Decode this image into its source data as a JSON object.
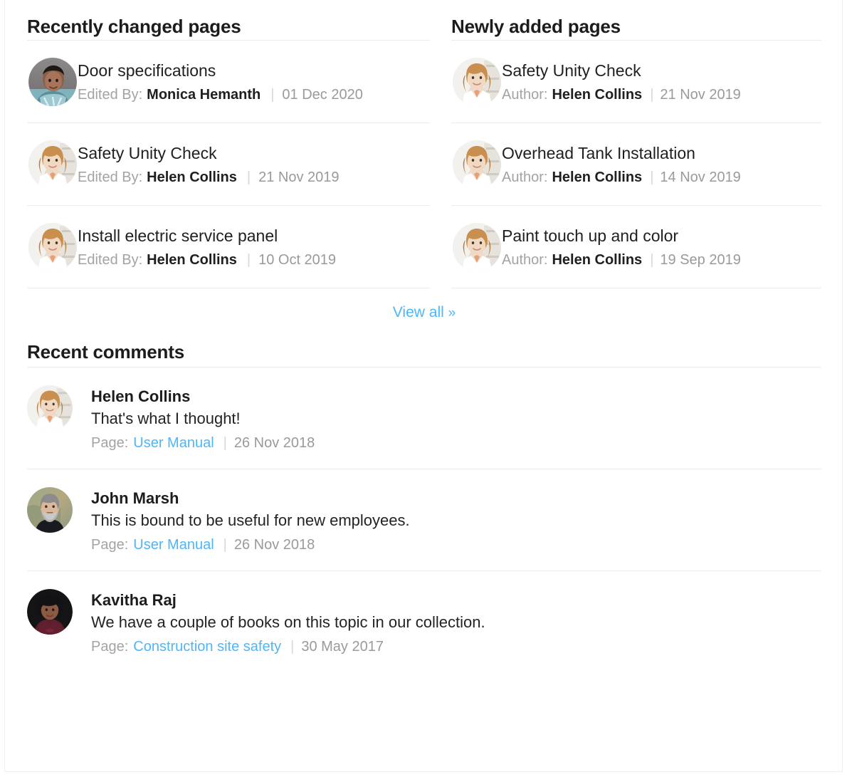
{
  "colors": {
    "link": "#4db6fb",
    "heading": "#1c1c1c",
    "muted": "#9a9a9a",
    "divider": "#ececec"
  },
  "recently_changed": {
    "title": "Recently changed pages",
    "items": [
      {
        "page": "Door  specifications",
        "label": "Edited By:",
        "user": "Monica Hemanth",
        "separator": "|",
        "date": "01 Dec 2020",
        "avatar": "monica"
      },
      {
        "page": "Safety Unity Check",
        "label": "Edited By:",
        "user": "Helen Collins",
        "separator": "|",
        "date": "21 Nov 2019",
        "avatar": "helen"
      },
      {
        "page": "Install electric service panel",
        "label": "Edited By:",
        "user": "Helen Collins",
        "separator": "|",
        "date": "10 Oct 2019",
        "avatar": "helen"
      }
    ]
  },
  "newly_added": {
    "title": "Newly added pages",
    "items": [
      {
        "page": "Safety Unity Check",
        "label": "Author:",
        "user": "Helen Collins",
        "separator": "|",
        "date": "21 Nov 2019",
        "avatar": "helen"
      },
      {
        "page": "Overhead Tank Installation",
        "label": "Author:",
        "user": "Helen Collins",
        "separator": "|",
        "date": "14 Nov 2019",
        "avatar": "helen"
      },
      {
        "page": "Paint touch up and color",
        "label": "Author:",
        "user": "Helen Collins",
        "separator": "|",
        "date": "19 Sep 2019",
        "avatar": "helen"
      }
    ]
  },
  "view_all": {
    "label": "View all",
    "chevron": "»"
  },
  "recent_comments": {
    "title": "Recent comments",
    "items": [
      {
        "author": "Helen Collins",
        "text": "That's what I thought!",
        "page_label": "Page:",
        "page_link": "User Manual",
        "separator": "|",
        "date": "26 Nov 2018",
        "avatar": "helen"
      },
      {
        "author": "John Marsh",
        "text": "This is bound to be useful for new employees.",
        "page_label": "Page:",
        "page_link": "User Manual",
        "separator": "|",
        "date": "26 Nov 2018",
        "avatar": "john"
      },
      {
        "author": "Kavitha Raj",
        "text": "We have a couple of books on this topic in our collection.",
        "page_label": "Page:",
        "page_link": "Construction site safety",
        "separator": "|",
        "date": "30 May 2017",
        "avatar": "kavitha"
      }
    ]
  }
}
